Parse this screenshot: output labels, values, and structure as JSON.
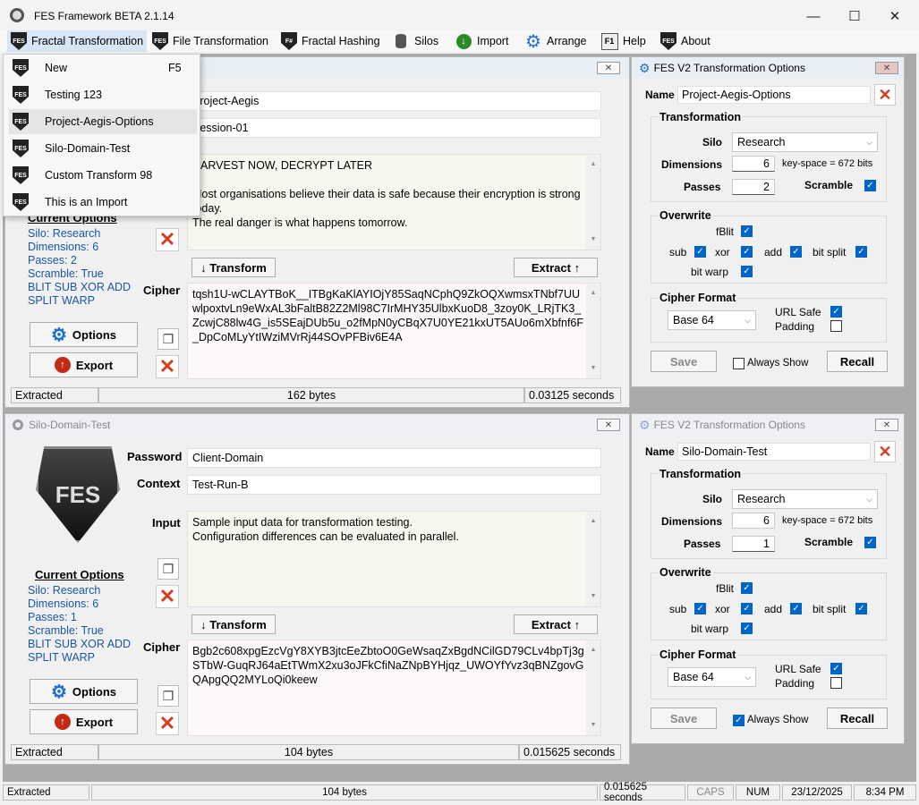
{
  "app": {
    "title": "FES Framework BETA 2.1.14"
  },
  "window_buttons": {
    "minimize": "—",
    "maximize": "☐",
    "close": "✕"
  },
  "menu": [
    {
      "label": "Fractal Transformation",
      "icon": "fes-shield-icon",
      "icon_text": "FES"
    },
    {
      "label": "File Transformation",
      "icon": "fes-shield-icon",
      "icon_text": "FES"
    },
    {
      "label": "Fractal Hashing",
      "icon": "fsharp-shield-icon",
      "icon_text": "F#"
    },
    {
      "label": "Silos",
      "icon": "database-icon"
    },
    {
      "label": "Import",
      "icon": "download-icon"
    },
    {
      "label": "Arrange",
      "icon": "gear-icon"
    },
    {
      "label": "Help",
      "icon": "f1-key-icon",
      "icon_text": "F1"
    },
    {
      "label": "About",
      "icon": "fes-shield-icon",
      "icon_text": "FES"
    }
  ],
  "dropdown": [
    {
      "label": "New",
      "shortcut": "F5"
    },
    {
      "label": "Testing 123",
      "shortcut": ""
    },
    {
      "label": "Project-Aegis-Options",
      "shortcut": ""
    },
    {
      "label": "Silo-Domain-Test",
      "shortcut": ""
    },
    {
      "label": "Custom Transform 98",
      "shortcut": ""
    },
    {
      "label": "This is an Import",
      "shortcut": ""
    }
  ],
  "win1": {
    "password": "Project-Aegis",
    "context": "Session-01",
    "input_lines": [
      "HARVEST NOW, DECRYPT LATER",
      "",
      "Most organisations believe their data is safe because their encryption is strong today.",
      "The real danger is what happens tomorrow."
    ],
    "current_options_title": "Current Options",
    "options": [
      "Silo: Research",
      "Dimensions: 6",
      "Passes: 2",
      "Scramble: True",
      "BLIT SUB XOR ADD",
      "SPLIT WARP"
    ],
    "transform_btn": "↓ Transform",
    "extract_btn": "Extract ↑",
    "cipher_label": "Cipher",
    "cipher": "tqsh1U-wCLAYTBoK__ITBgKaKlAYIOjY85SaqNCphQ9ZkOQXwmsxTNbf7UUwlpoxtvLn9eWxAL3bFaltB82Z2Ml98C7IrMHY35UlbxKuoD8_3zoy0K_LRjTK3_ZcwjC88lw4G_is5SEajDUb5u_o2fMpN0yCBqX7U0YE21kxUT5AUo6mXbfnf6F_DpCoMLyYtIWziMVrRj44SOvPFBiv6E4A",
    "options_btn": "Options",
    "export_btn": "Export",
    "status": {
      "state": "Extracted",
      "size": "162 bytes",
      "time": "0.03125 seconds"
    }
  },
  "win2": {
    "title": "Silo-Domain-Test",
    "password_label": "Password",
    "context_label": "Context",
    "input_label": "Input",
    "password": "Client-Domain",
    "context": "Test-Run-B",
    "input_lines": [
      "Sample input data for transformation testing.",
      "Configuration differences can be evaluated in parallel."
    ],
    "logo_text": "FES",
    "current_options_title": "Current Options",
    "options": [
      "Silo: Research",
      "Dimensions: 6",
      "Passes: 1",
      "Scramble: True",
      "BLIT SUB XOR ADD",
      "SPLIT WARP"
    ],
    "transform_btn": "↓ Transform",
    "extract_btn": "Extract ↑",
    "cipher_label": "Cipher",
    "cipher": "Bgb2c608xpgEzcVgY8XYB3jtcEeZbtoO0GeWsaqZxBgdNCilGD79CLv4bpTj3gSTbW-GuqRJ64aEtTWmX2xu3oJFkCfiNaZNpBYHjqz_UWOYfYvz3qBNZgovGQApgQQ2MYLoQi0keew",
    "options_btn": "Options",
    "export_btn": "Export",
    "status": {
      "state": "Extracted",
      "size": "104 bytes",
      "time": "0.015625 seconds"
    }
  },
  "opt1": {
    "title": "FES V2 Transformation Options",
    "name_label": "Name",
    "name": "Project-Aegis-Options",
    "transformation_title": "Transformation",
    "silo_label": "Silo",
    "silo": "Research",
    "dimensions_label": "Dimensions",
    "dimensions": "6",
    "keyspace": "key-space = 672 bits",
    "passes_label": "Passes",
    "passes": "2",
    "scramble_label": "Scramble",
    "overwrite_title": "Overwrite",
    "fblit": "fBlit",
    "sub": "sub",
    "xor": "xor",
    "add": "add",
    "bitsplit": "bit split",
    "bitwarp": "bit warp",
    "cipher_format_title": "Cipher Format",
    "format": "Base 64",
    "urlsafe": "URL Safe",
    "padding": "Padding",
    "save_btn": "Save",
    "always_show": "Always Show",
    "always_show_checked": false,
    "recall_btn": "Recall"
  },
  "opt2": {
    "title": "FES V2 Transformation Options",
    "name_label": "Name",
    "name": "Silo-Domain-Test",
    "transformation_title": "Transformation",
    "silo_label": "Silo",
    "silo": "Research",
    "dimensions_label": "Dimensions",
    "dimensions": "6",
    "keyspace": "key-space = 672 bits",
    "passes_label": "Passes",
    "passes": "1",
    "scramble_label": "Scramble",
    "overwrite_title": "Overwrite",
    "fblit": "fBlit",
    "sub": "sub",
    "xor": "xor",
    "add": "add",
    "bitsplit": "bit split",
    "bitwarp": "bit warp",
    "cipher_format_title": "Cipher Format",
    "format": "Base 64",
    "urlsafe": "URL Safe",
    "padding": "Padding",
    "save_btn": "Save",
    "always_show": "Always Show",
    "always_show_checked": true,
    "recall_btn": "Recall"
  },
  "appstatus": {
    "state": "Extracted",
    "size": "104 bytes",
    "time": "0.015625 seconds",
    "caps": "CAPS",
    "num": "NUM",
    "date": "23/12/2025",
    "clock": "8:34 PM"
  },
  "colors": {
    "accent": "#0064c8",
    "clear_red": "#d63c1e",
    "option_blue": "#1a56a6"
  }
}
